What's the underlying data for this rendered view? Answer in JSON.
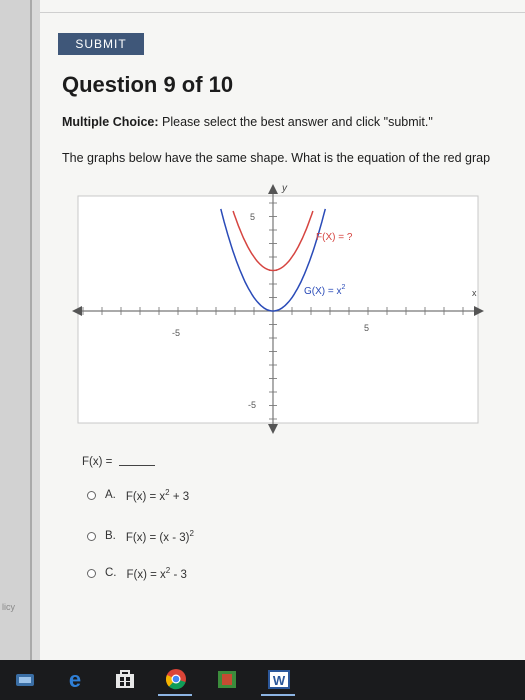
{
  "header": {
    "submit_label": "SUBMIT"
  },
  "question": {
    "title": "Question 9 of 10",
    "type_label": "Multiple Choice:",
    "instruction": " Please select the best answer and click \"submit.\"",
    "prompt": "The graphs below have the same shape. What is the equation of the red grap"
  },
  "graph": {
    "y_axis_label": "y",
    "x_axis_label": "x",
    "tick_y_pos": "5",
    "tick_y_neg": "-5",
    "tick_x_neg": "-5",
    "tick_x_pos": "5",
    "f_label": "F(X) = ?",
    "g_label_base": "G(X) = x",
    "g_label_exp": "2",
    "red_curve_color": "#d64541",
    "blue_curve_color": "#2a4bb8",
    "chart_data": {
      "type": "line",
      "xlim": [
        -8,
        8
      ],
      "ylim": [
        -8,
        8
      ],
      "series": [
        {
          "name": "F(X) = ?",
          "color": "red",
          "x": [
            -2,
            -1.5,
            -1,
            -0.5,
            0,
            0.5,
            1,
            1.5,
            2
          ],
          "y": [
            7,
            5.25,
            4,
            3.25,
            3,
            3.25,
            4,
            5.25,
            7
          ]
        },
        {
          "name": "G(X) = x2",
          "color": "blue",
          "x": [
            -2.7,
            -2,
            -1.5,
            -1,
            -0.5,
            0,
            0.5,
            1,
            1.5,
            2,
            2.7
          ],
          "y": [
            7.29,
            4,
            2.25,
            1,
            0.25,
            0,
            0.25,
            1,
            2.25,
            4,
            7.29
          ]
        }
      ]
    }
  },
  "answer_blank": "F(x) = ",
  "choices": [
    {
      "letter": "A.",
      "eq_base": "F(x) = x",
      "eq_exp": "2",
      "eq_tail": " + 3"
    },
    {
      "letter": "B.",
      "eq_base": "F(x) = (x - 3)",
      "eq_exp": "2",
      "eq_tail": ""
    },
    {
      "letter": "C.",
      "eq_base": "F(x) = x",
      "eq_exp": "2",
      "eq_tail": " - 3"
    }
  ],
  "sidebar": {
    "policy_text": "licy"
  },
  "taskbar": {
    "icons": [
      "start-icon",
      "edge-browser-icon",
      "store-icon",
      "chrome-icon",
      "media-icon",
      "word-icon"
    ],
    "word_letter": "W"
  }
}
